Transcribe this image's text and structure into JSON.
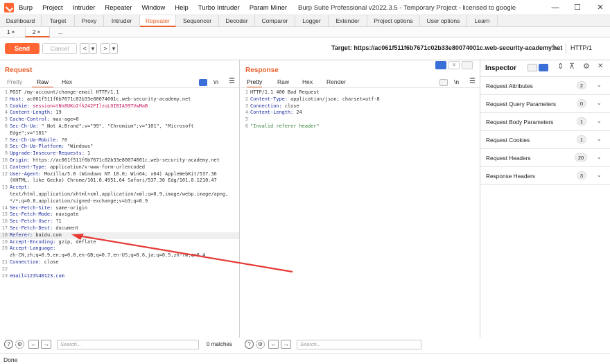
{
  "menu": [
    "Burp",
    "Project",
    "Intruder",
    "Repeater",
    "Window",
    "Help",
    "Turbo Intruder",
    "Param Miner"
  ],
  "window_title": "Burp Suite Professional v2022.3.5 - Temporary Project - licensed to google",
  "window_controls": [
    "—",
    "☐",
    "✕"
  ],
  "main_tabs": [
    "Dashboard",
    "Target",
    "Proxy",
    "Intruder",
    "Repeater",
    "Sequencer",
    "Decoder",
    "Comparer",
    "Logger",
    "Extender",
    "Project options",
    "User options",
    "Learn"
  ],
  "sub_tabs": [
    "1 ×",
    "2 ×",
    "..."
  ],
  "toolbar": {
    "send": "Send",
    "cancel": "Cancel",
    "back": "<",
    "back_menu": "▾",
    "forward": ">",
    "forward_menu": "▾",
    "target": "Target: https://ac061f511f6b7671c02b33e80074001c.web-security-academy.net",
    "http_version": "HTTP/1"
  },
  "request": {
    "title": "Request",
    "tabs": [
      "Pretty",
      "Raw",
      "Hex"
    ],
    "newline_toggle": "\\n",
    "lines": [
      [
        "1",
        "",
        "POST /my-account/change-email HTTP/1.1"
      ],
      [
        "2",
        "Host:",
        " ac061f511f6b7671c02b33e80074001c.web-security-academy.net"
      ],
      [
        "3",
        "Cookie:",
        " session=tNn8UKo2fk242FIlzuLOIBIA99TVwMaB"
      ],
      [
        "4",
        "Content-Length:",
        " 19"
      ],
      [
        "5",
        "Cache-Control:",
        " max-age=0"
      ],
      [
        "6",
        "Sec-Ch-Ua:",
        " \" Not A;Brand\";v=\"99\", \"Chromium\";v=\"101\", \"Microsoft"
      ],
      [
        "",
        "",
        "Edge\";v=\"101\""
      ],
      [
        "7",
        "Sec-Ch-Ua-Mobile:",
        " ?0"
      ],
      [
        "8",
        "Sec-Ch-Ua-Platform:",
        " \"Windows\""
      ],
      [
        "9",
        "Upgrade-Insecure-Requests:",
        " 1"
      ],
      [
        "10",
        "Origin:",
        " https://ac061f511f6b7671c02b33e80074001c.web-security-academy.net"
      ],
      [
        "11",
        "Content-Type:",
        " application/x-www-form-urlencoded"
      ],
      [
        "12",
        "User-Agent:",
        " Mozilla/5.0 (Windows NT 10.0; Win64; x64) AppleWebKit/537.36"
      ],
      [
        "",
        "",
        "(KHTML, like Gecko) Chrome/101.0.4951.64 Safari/537.36 Edg/101.0.1210.47"
      ],
      [
        "13",
        "Accept:",
        ""
      ],
      [
        "",
        "",
        "text/html,application/xhtml+xml,application/xml;q=0.9,image/webp,image/apng,"
      ],
      [
        "",
        "",
        "*/*;q=0.8,application/signed-exchange;v=b3;q=0.9"
      ],
      [
        "14",
        "Sec-Fetch-Site:",
        " same-origin"
      ],
      [
        "15",
        "Sec-Fetch-Mode:",
        " navigate"
      ],
      [
        "16",
        "Sec-Fetch-User:",
        " ?1"
      ],
      [
        "17",
        "Sec-Fetch-Dest:",
        " document"
      ],
      [
        "18",
        "Referer:",
        " baidu.com"
      ],
      [
        "19",
        "Accept-Encoding:",
        " gzip, deflate"
      ],
      [
        "20",
        "Accept-Language:",
        ""
      ],
      [
        "",
        "",
        "zh-CN,zh;q=0.9,en;q=0.8,en-GB;q=0.7,en-US;q=0.6,ja;q=0.5,zh-TW;q=0.4"
      ],
      [
        "21",
        "Connection:",
        " close"
      ],
      [
        "22",
        "",
        ""
      ],
      [
        "23",
        "",
        "email=123%40123.com"
      ]
    ],
    "search_placeholder": "Search...",
    "matches": "0 matches"
  },
  "response": {
    "title": "Response",
    "tabs": [
      "Pretty",
      "Raw",
      "Hex",
      "Render"
    ],
    "newline_toggle": "\\n",
    "lines": [
      [
        "1",
        "",
        "HTTP/1.1 400 Bad Request"
      ],
      [
        "2",
        "Content-Type:",
        " application/json; charset=utf-8"
      ],
      [
        "3",
        "Connection:",
        " close"
      ],
      [
        "4",
        "Content-Length:",
        " 24"
      ],
      [
        "5",
        "",
        ""
      ],
      [
        "6",
        "",
        "\"Invalid referer header\""
      ]
    ],
    "search_placeholder": "Search..."
  },
  "inspector": {
    "title": "Inspector",
    "close": "✕",
    "sections": [
      {
        "label": "Request Attributes",
        "count": "2"
      },
      {
        "label": "Request Query Parameters",
        "count": "0"
      },
      {
        "label": "Request Body Parameters",
        "count": "1"
      },
      {
        "label": "Request Cookies",
        "count": "1"
      },
      {
        "label": "Request Headers",
        "count": "20"
      },
      {
        "label": "Response Headers",
        "count": "3"
      }
    ]
  },
  "status": "Done",
  "colors": {
    "accent": "#e8602c",
    "send_button": "#ff6633",
    "annotation_arrow": "#e53935",
    "header_key": "#1a2a9c",
    "cookie_value": "#c2185b",
    "string_value": "#2e7d32"
  }
}
